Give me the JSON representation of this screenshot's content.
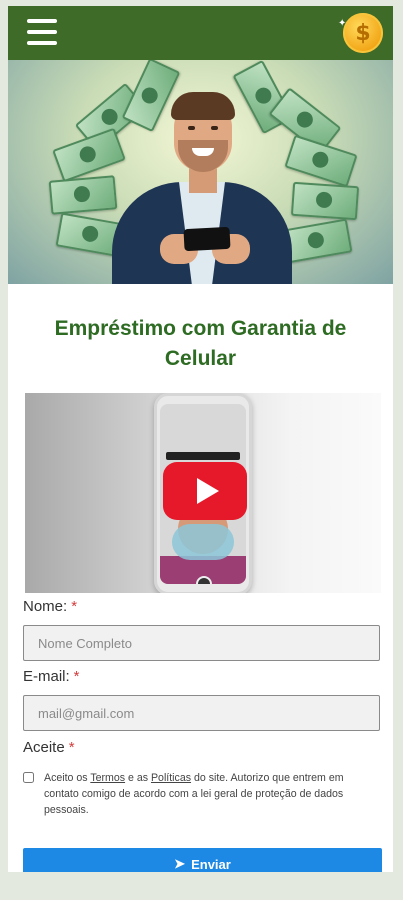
{
  "header": {
    "menu_icon": "hamburger-menu-icon",
    "coin_icon": "dollar-coin-icon",
    "coin_symbol": "$",
    "background_color": "#3f6b28"
  },
  "hero": {
    "image": "smiling-man-holding-phone-with-money-bills"
  },
  "page_title": {
    "line1": "Empréstimo com Garantia de",
    "line2": "Celular"
  },
  "video": {
    "play_icon": "youtube-play-icon",
    "play_color": "#e6192b"
  },
  "form": {
    "name_label": "Nome:",
    "name_required": "*",
    "name_placeholder": "Nome Completo",
    "email_label": "E-mail:",
    "email_required": "*",
    "email_placeholder": "mail@gmail.com",
    "accept_label": "Aceite",
    "accept_required": "*",
    "consent_prefix": "Aceito os ",
    "consent_terms": "Termos",
    "consent_middle": " e as ",
    "consent_policies": "Políticas",
    "consent_suffix": " do site. Autorizo que entrem em contato comigo de acordo com a lei geral de proteção de dados pessoais.",
    "submit_label": "Enviar",
    "submit_icon": "paper-plane-icon",
    "submit_color": "#1e88e5"
  },
  "colors": {
    "title": "#2e6b23",
    "required": "#d43b3b"
  }
}
